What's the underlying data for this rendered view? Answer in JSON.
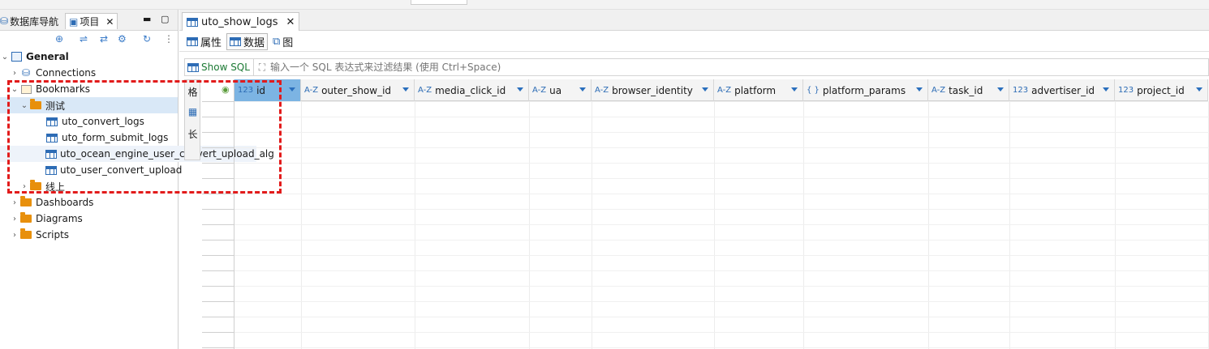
{
  "left_panel": {
    "tabs": [
      {
        "label": "数据库导航"
      },
      {
        "label": "项目"
      }
    ],
    "close_glyph": "✕",
    "tree": [
      {
        "label": "General",
        "icon": "project-icon",
        "bold": true
      },
      {
        "label": "Connections",
        "icon": "connections-icon"
      },
      {
        "label": "Bookmarks",
        "icon": "bookmarks-icon"
      },
      {
        "label": "测试",
        "icon": "folder-icon"
      },
      {
        "label": "uto_convert_logs",
        "icon": "table-icon"
      },
      {
        "label": "uto_form_submit_logs",
        "icon": "table-icon"
      },
      {
        "label": "uto_ocean_engine_user_convert_upload_alg",
        "icon": "table-icon"
      },
      {
        "label": "uto_user_convert_upload",
        "icon": "table-icon"
      },
      {
        "label": "线上",
        "icon": "folder-icon"
      },
      {
        "label": "Dashboards",
        "icon": "dashboards-icon"
      },
      {
        "label": "Diagrams",
        "icon": "diagrams-icon"
      },
      {
        "label": "Scripts",
        "icon": "scripts-icon"
      }
    ]
  },
  "editor": {
    "tab_title": "uto_show_logs",
    "close_glyph": "✕",
    "subtabs": [
      {
        "label": "属性"
      },
      {
        "label": "数据"
      },
      {
        "label": "图"
      }
    ],
    "show_sql_label": "Show SQL",
    "filter_placeholder": "输入一个 SQL 表达式来过滤结果 (使用 Ctrl+Space)",
    "side_tabs": [
      "格",
      "长"
    ],
    "columns": [
      {
        "type": "123",
        "name": "id"
      },
      {
        "type": "A-Z",
        "name": "outer_show_id"
      },
      {
        "type": "A-Z",
        "name": "media_click_id"
      },
      {
        "type": "A-Z",
        "name": "ua"
      },
      {
        "type": "A-Z",
        "name": "browser_identity"
      },
      {
        "type": "A-Z",
        "name": "platform"
      },
      {
        "type": "{ }",
        "name": "platform_params"
      },
      {
        "type": "A-Z",
        "name": "task_id"
      },
      {
        "type": "123",
        "name": "advertiser_id"
      },
      {
        "type": "123",
        "name": "project_id"
      }
    ]
  },
  "colors": {
    "highlight": "#e21b1b",
    "selection": "#d9e8f7",
    "accent": "#2d6cb5"
  }
}
